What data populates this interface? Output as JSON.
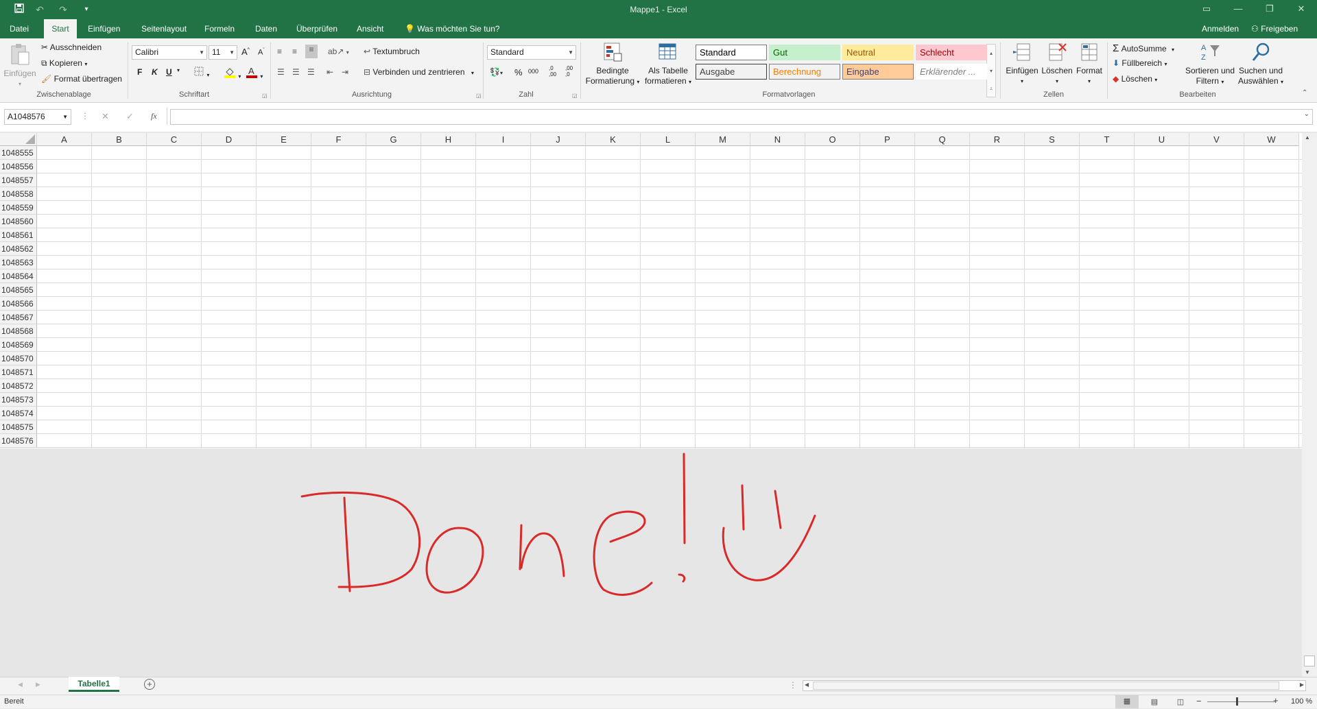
{
  "app": {
    "window_title": "Mappe1 - Excel",
    "signin_label": "Anmelden",
    "share_label": "Freigeben",
    "tell_me": "Was möchten Sie tun?"
  },
  "tabs": [
    "Datei",
    "Start",
    "Einfügen",
    "Seitenlayout",
    "Formeln",
    "Daten",
    "Überprüfen",
    "Ansicht"
  ],
  "clipboard": {
    "paste": "Einfügen",
    "cut": "Ausschneiden",
    "copy": "Kopieren",
    "format_painter": "Format übertragen",
    "group": "Zwischenablage"
  },
  "font": {
    "name": "Calibri",
    "size": "11",
    "bold": "F",
    "italic": "K",
    "underline": "U",
    "group": "Schriftart",
    "font_color": "#c00000",
    "fill_color": "#ffff00"
  },
  "alignment": {
    "wrap": "Textumbruch",
    "merge": "Verbinden und zentrieren",
    "group": "Ausrichtung"
  },
  "number": {
    "format": "Standard",
    "percent": "%",
    "thousands": "000",
    "increase_decimal": ",0 ,00",
    "decrease_decimal": ",00 ,0",
    "group": "Zahl"
  },
  "styles": {
    "conditional": [
      "Bedingte",
      "Formatierung"
    ],
    "as_table": [
      "Als Tabelle",
      "formatieren"
    ],
    "cells": [
      {
        "label": "Standard",
        "bg": "#ffffff",
        "fg": "#000000",
        "border": "#7a7a7a"
      },
      {
        "label": "Gut",
        "bg": "#c6efce",
        "fg": "#006100",
        "border": "#c6efce"
      },
      {
        "label": "Neutral",
        "bg": "#ffeb9c",
        "fg": "#9c5700",
        "border": "#ffeb9c"
      },
      {
        "label": "Schlecht",
        "bg": "#ffc7ce",
        "fg": "#9c0006",
        "border": "#ffc7ce"
      },
      {
        "label": "Ausgabe",
        "bg": "#f2f2f2",
        "fg": "#3f3f3f",
        "border": "#3f3f3f"
      },
      {
        "label": "Berechnung",
        "bg": "#f2f2f2",
        "fg": "#fa7d00",
        "border": "#7f7f7f"
      },
      {
        "label": "Eingabe",
        "bg": "#ffcc99",
        "fg": "#3f3f76",
        "border": "#7f7f7f"
      },
      {
        "label": "Erklärender ...",
        "bg": "#ffffff",
        "fg": "#7f7f7f",
        "border": "#ffffff"
      }
    ],
    "group": "Formatvorlagen"
  },
  "cells_group": {
    "insert": "Einfügen",
    "delete": "Löschen",
    "format": "Format",
    "group": "Zellen"
  },
  "editing": {
    "autosum": "AutoSumme",
    "fill": "Füllbereich",
    "clear": "Löschen",
    "sort": [
      "Sortieren und",
      "Filtern"
    ],
    "find": [
      "Suchen und",
      "Auswählen"
    ],
    "group": "Bearbeiten"
  },
  "formula_bar": {
    "name_box": "A1048576",
    "fx": "fx",
    "value": ""
  },
  "columns": [
    "A",
    "B",
    "C",
    "D",
    "E",
    "F",
    "G",
    "H",
    "I",
    "J",
    "K",
    "L",
    "M",
    "N",
    "O",
    "P",
    "Q",
    "R",
    "S",
    "T",
    "U",
    "V",
    "W"
  ],
  "rows": [
    "1048555",
    "1048556",
    "1048557",
    "1048558",
    "1048559",
    "1048560",
    "1048561",
    "1048562",
    "1048563",
    "1048564",
    "1048565",
    "1048566",
    "1048567",
    "1048568",
    "1048569",
    "1048570",
    "1048571",
    "1048572",
    "1048573",
    "1048574",
    "1048575",
    "1048576"
  ],
  "sheet": {
    "tab": "Tabelle1"
  },
  "status": {
    "ready": "Bereit",
    "zoom": "100 %"
  },
  "drawing": {
    "text": "Done!",
    "color": "#d92a2a"
  }
}
